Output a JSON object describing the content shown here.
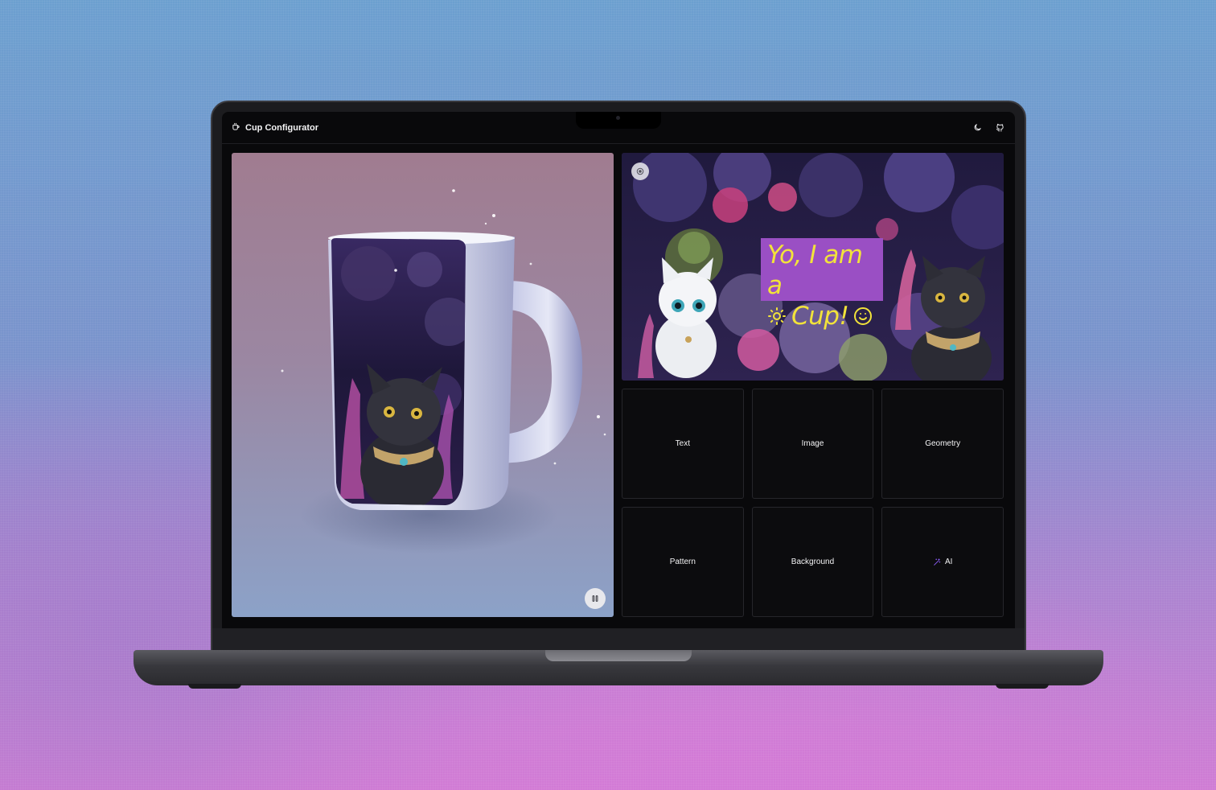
{
  "app": {
    "title": "Cup Configurator"
  },
  "header": {
    "actions": [
      {
        "icon": "moon-icon",
        "label": "Toggle theme"
      },
      {
        "icon": "github-icon",
        "label": "GitHub"
      }
    ]
  },
  "viewer": {
    "pause_icon": "pause-icon"
  },
  "preview": {
    "text_line1": "Yo, I am a",
    "text_line2": "Cup!",
    "text_color": "#f2e33a",
    "text_bg": "#9a4fc4"
  },
  "tools": [
    {
      "label": "Text"
    },
    {
      "label": "Image"
    },
    {
      "label": "Geometry"
    },
    {
      "label": "Pattern"
    },
    {
      "label": "Background"
    },
    {
      "label": "AI",
      "icon": "magic-wand-icon",
      "icon_color": "#8b5cf6"
    }
  ]
}
